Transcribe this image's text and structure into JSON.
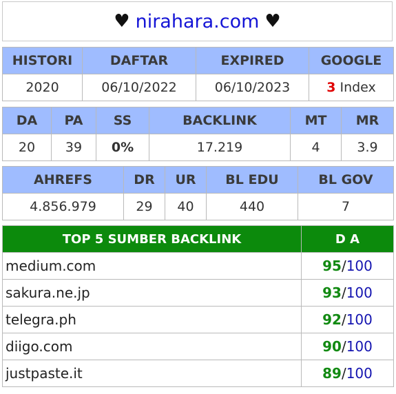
{
  "header": {
    "heart_left": "♥",
    "domain": "nirahara.com",
    "heart_right": "♥"
  },
  "table1": {
    "headers": [
      "HISTORI",
      "DAFTAR",
      "EXPIRED",
      "GOOGLE"
    ],
    "values": {
      "histori": "2020",
      "daftar": "06/10/2022",
      "expired": "06/10/2023",
      "google_count": "3",
      "google_suffix": " Index"
    }
  },
  "table2": {
    "headers": [
      "DA",
      "PA",
      "SS",
      "BACKLINK",
      "MT",
      "MR"
    ],
    "values": [
      "20",
      "39",
      "0%",
      "17.219",
      "4",
      "3.9"
    ]
  },
  "table3": {
    "headers": [
      "AHREFS",
      "DR",
      "UR",
      "BL EDU",
      "BL GOV"
    ],
    "values": [
      "4.856.979",
      "29",
      "40",
      "440",
      "7"
    ]
  },
  "top_backlinks": {
    "header_left": "TOP 5 SUMBER BACKLINK",
    "header_right": "D A",
    "rows": [
      {
        "site": "medium.com",
        "da": "95",
        "sep": "/",
        "max": "100"
      },
      {
        "site": "sakura.ne.jp",
        "da": "93",
        "sep": "/",
        "max": "100"
      },
      {
        "site": "telegra.ph",
        "da": "92",
        "sep": "/",
        "max": "100"
      },
      {
        "site": "diigo.com",
        "da": "90",
        "sep": "/",
        "max": "100"
      },
      {
        "site": "justpaste.it",
        "da": "89",
        "sep": "/",
        "max": "100"
      }
    ]
  },
  "colors": {
    "header_blue": "#9fbcff",
    "top_green": "#0c8a0c",
    "domain_blue": "#1414d6",
    "red": "#e00000"
  }
}
